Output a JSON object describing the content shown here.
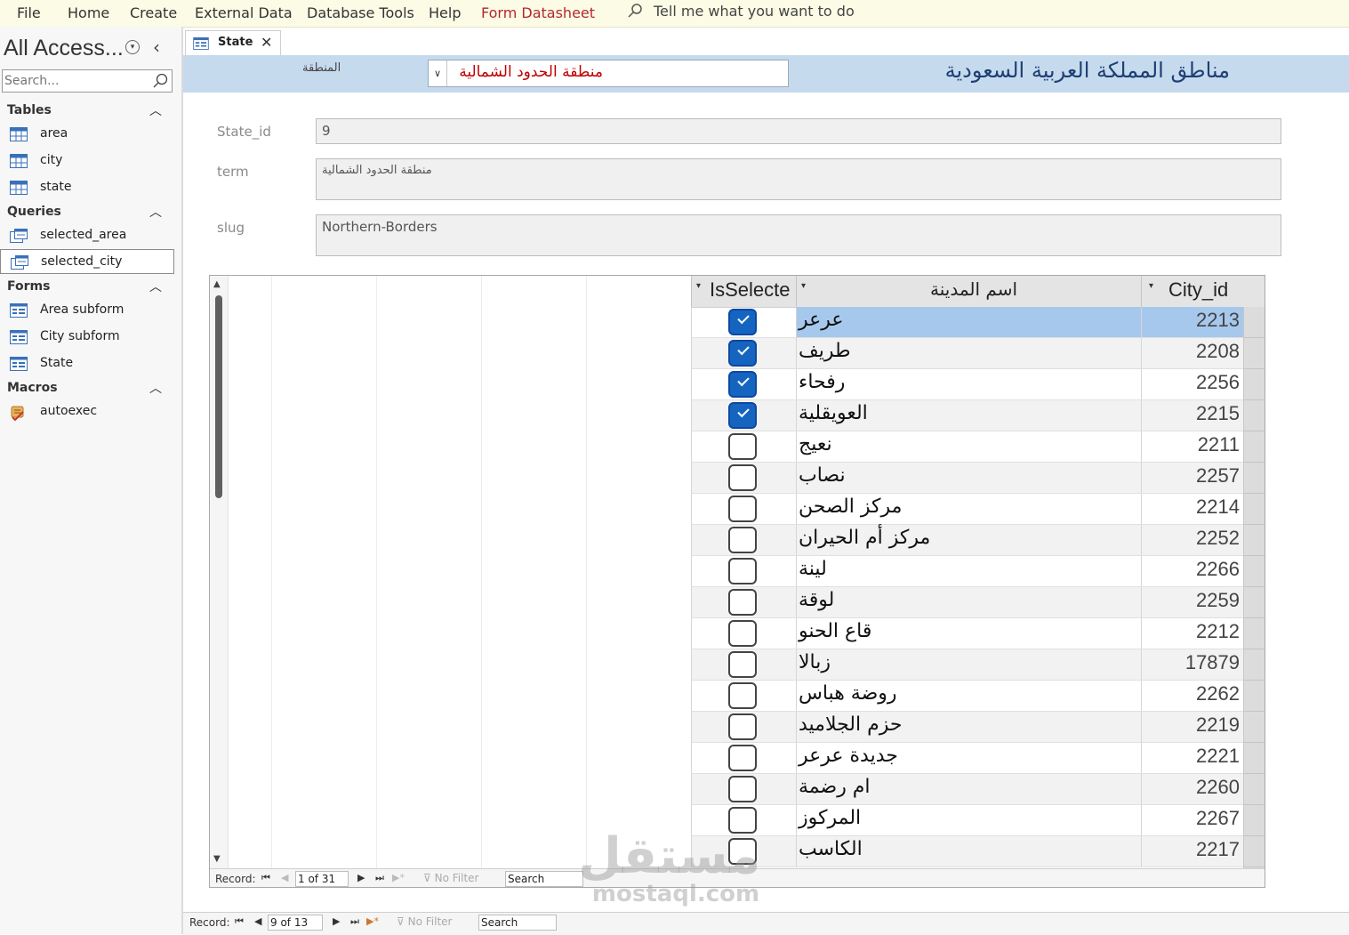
{
  "ribbon": {
    "menus": [
      "File",
      "Home",
      "Create",
      "External Data",
      "Database Tools",
      "Help"
    ],
    "contextual_tab": "Form Datasheet",
    "tell_me": "Tell me what you want to do"
  },
  "nav": {
    "title": "All Access...",
    "search_placeholder": "Search...",
    "groups": {
      "tables": {
        "label": "Tables",
        "items": [
          "area",
          "city",
          "state"
        ]
      },
      "queries": {
        "label": "Queries",
        "items": [
          "selected_area",
          "selected_city"
        ]
      },
      "forms": {
        "label": "Forms",
        "items": [
          "Area subform",
          "City subform",
          "State"
        ]
      },
      "macros": {
        "label": "Macros",
        "items": [
          "autoexec"
        ]
      }
    },
    "selected_item": "selected_city"
  },
  "document": {
    "tab_label": "State"
  },
  "form": {
    "title": "مناطق المملكة العربية السعودية",
    "region_label": "المنطقة",
    "region_value": "منطقة الحدود الشمالية",
    "fields": {
      "state_id": {
        "label": "State_id",
        "value": "9"
      },
      "term": {
        "label": "term",
        "value": "منطقة الحدود الشمالية"
      },
      "slug": {
        "label": "slug",
        "value": "Northern-Borders"
      }
    }
  },
  "subform": {
    "columns": {
      "selected": "IsSelecte",
      "name": "اسم المدينة",
      "id": "City_id"
    },
    "rows": [
      {
        "id": "2213",
        "name": "عرعر",
        "checked": true,
        "current": true
      },
      {
        "id": "2208",
        "name": "طريف",
        "checked": true
      },
      {
        "id": "2256",
        "name": "رفحاء",
        "checked": true
      },
      {
        "id": "2215",
        "name": "العويقلية",
        "checked": true
      },
      {
        "id": "2211",
        "name": "نعيج",
        "checked": false
      },
      {
        "id": "2257",
        "name": "نصاب",
        "checked": false
      },
      {
        "id": "2214",
        "name": "مركز الصحن",
        "checked": false
      },
      {
        "id": "2252",
        "name": "مركز أم الحيران",
        "checked": false
      },
      {
        "id": "2266",
        "name": "لينة",
        "checked": false
      },
      {
        "id": "2259",
        "name": "لوقة",
        "checked": false
      },
      {
        "id": "2212",
        "name": "قاع الحنو",
        "checked": false
      },
      {
        "id": "17879",
        "name": "زبالا",
        "checked": false
      },
      {
        "id": "2262",
        "name": "روضة هباس",
        "checked": false
      },
      {
        "id": "2219",
        "name": "حزم الجلاميد",
        "checked": false
      },
      {
        "id": "2221",
        "name": "جديدة عرعر",
        "checked": false
      },
      {
        "id": "2260",
        "name": "ام رضمة",
        "checked": false
      },
      {
        "id": "2267",
        "name": "المركوز",
        "checked": false
      },
      {
        "id": "2217",
        "name": "الكاسب",
        "checked": false
      }
    ],
    "record_nav": {
      "label": "Record:",
      "position": "1 of 31",
      "filter": "No Filter",
      "search": "Search"
    }
  },
  "main_record_nav": {
    "label": "Record:",
    "position": "9 of 13",
    "filter": "No Filter",
    "search": "Search"
  },
  "watermark": {
    "arabic": "مستقل",
    "latin": "mostaql.com"
  },
  "colors": {
    "contextual": "#b4282d",
    "header_band": "#c6daee",
    "selection": "#a6c8ec",
    "checkbox_on": "#1565c0"
  }
}
